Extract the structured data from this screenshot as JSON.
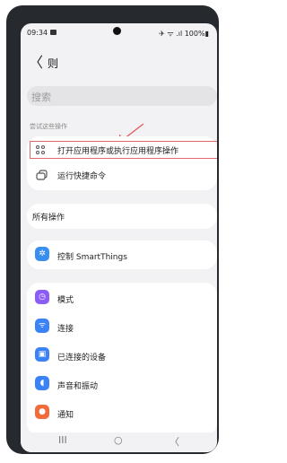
{
  "status": {
    "time": "09:34",
    "right": "✈ ᯤ .ıl 100%▮"
  },
  "header": {
    "back_glyph": "〈",
    "title": "则"
  },
  "search": {
    "placeholder": "搜索"
  },
  "section1": {
    "label": "尝试这些操作"
  },
  "rows": [
    {
      "label": "打开应用程序或执行应用程序操作",
      "icon": "apps-grid-icon"
    },
    {
      "label": "运行快捷命令",
      "icon": "shortcut-icon"
    }
  ],
  "section2": {
    "label": "所有操作"
  },
  "smartthings": {
    "label": "控制 SmartThings",
    "color": "#3a8ef0"
  },
  "settings": [
    {
      "label": "模式",
      "color": "#8b5cf6",
      "glyph": "◷"
    },
    {
      "label": "连接",
      "color": "#3b82f6",
      "glyph": "ᯤ"
    },
    {
      "label": "已连接的设备",
      "color": "#3b82f6",
      "glyph": "▣"
    },
    {
      "label": "声音和振动",
      "color": "#3b82f6",
      "glyph": "◖"
    },
    {
      "label": "通知",
      "color": "#f26b3a",
      "glyph": "●"
    }
  ],
  "navbar": {
    "recent": "III",
    "home": "○",
    "back": "〈"
  }
}
